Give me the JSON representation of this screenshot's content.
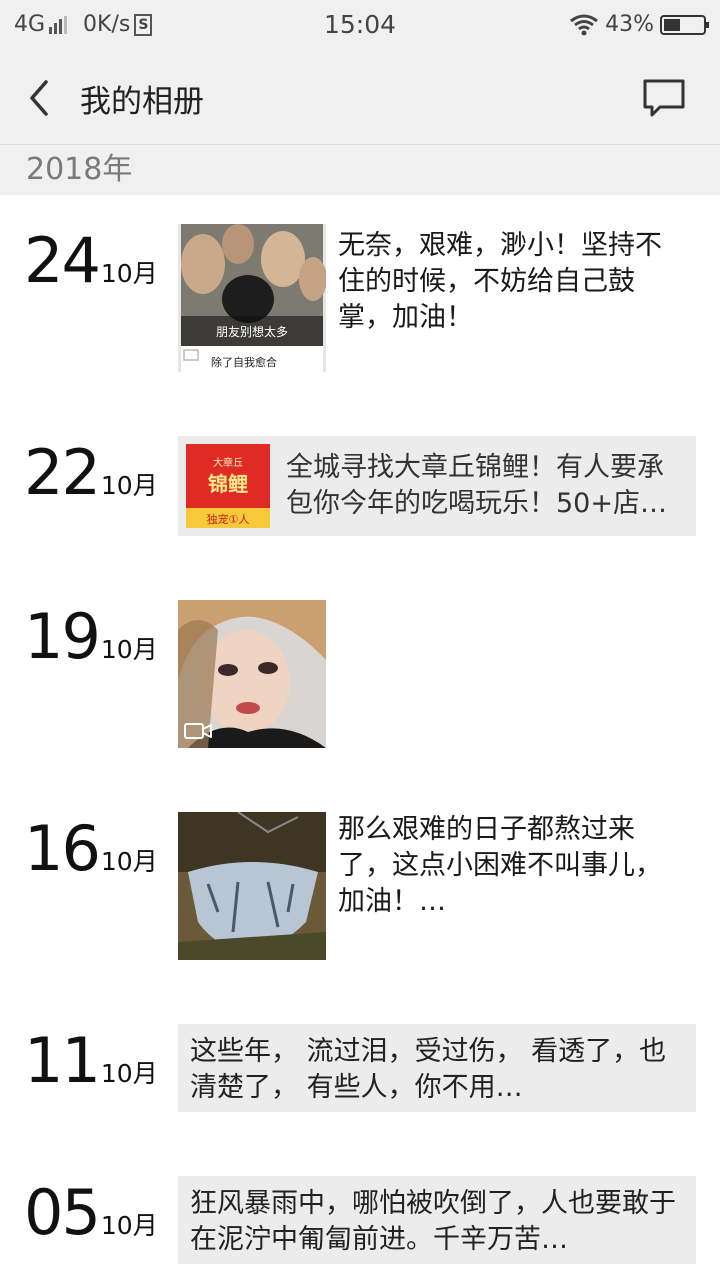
{
  "status": {
    "network": "4G",
    "speed": "0K/s",
    "s_badge": "S",
    "time": "15:04",
    "battery": "43%",
    "battery_level": 0.43
  },
  "nav": {
    "title": "我的相册"
  },
  "year": "2018年",
  "posts": [
    {
      "day": "24",
      "month": "10月",
      "text": "无奈，艰难，渺小！坚持不住的时候，不妨给自己鼓掌，加油！",
      "thumb_caption1": "朋友别想太多",
      "thumb_caption2": "除了自我愈合"
    },
    {
      "day": "22",
      "month": "10月",
      "share_text": "全城寻找大章丘锦鲤！有人要承包你今年的吃喝玩乐！50+店…",
      "thumb_badge_top": "大章丘",
      "thumb_badge_main": "锦鲤",
      "thumb_badge_bottom": "独宠①人"
    },
    {
      "day": "19",
      "month": "10月"
    },
    {
      "day": "16",
      "month": "10月",
      "text": "那么艰难的日子都熬过来了，这点小困难不叫事儿，加油！…"
    },
    {
      "day": "11",
      "month": "10月",
      "share_text": "这些年， 流过泪，受过伤， 看透了，也清楚了， 有些人，你不用…"
    },
    {
      "day": "05",
      "month": "10月",
      "share_text": "狂风暴雨中，哪怕被吹倒了，人也要敢于在泥泞中匍匐前进。千辛万苦…"
    }
  ]
}
